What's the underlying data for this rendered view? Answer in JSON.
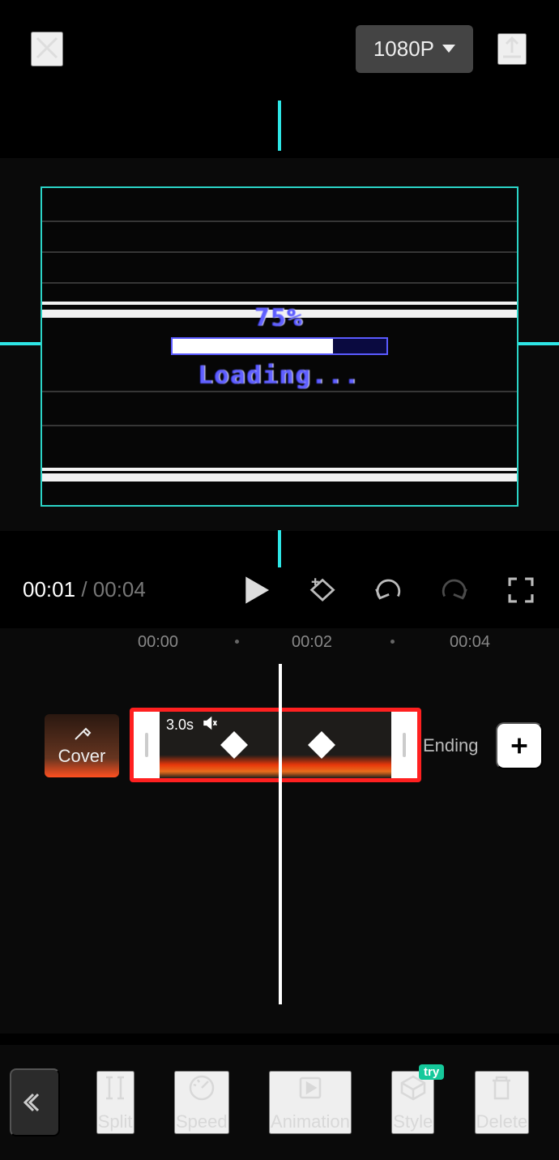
{
  "header": {
    "resolution_label": "1080P"
  },
  "preview": {
    "progress_text": "75%",
    "loading_text": "Loading..."
  },
  "playback": {
    "current_time": "00:01",
    "separator": "/",
    "total_time": "00:04"
  },
  "ruler": {
    "marks": [
      "00:00",
      "00:02",
      "00:04"
    ]
  },
  "clip": {
    "duration_label": "3.0s",
    "muted": true,
    "cover_label": "Cover",
    "ending_label": "Ending"
  },
  "tools": {
    "split": "Split",
    "speed": "Speed",
    "animation": "Animation",
    "style": "Style",
    "style_badge": "try",
    "delete": "Delete"
  }
}
